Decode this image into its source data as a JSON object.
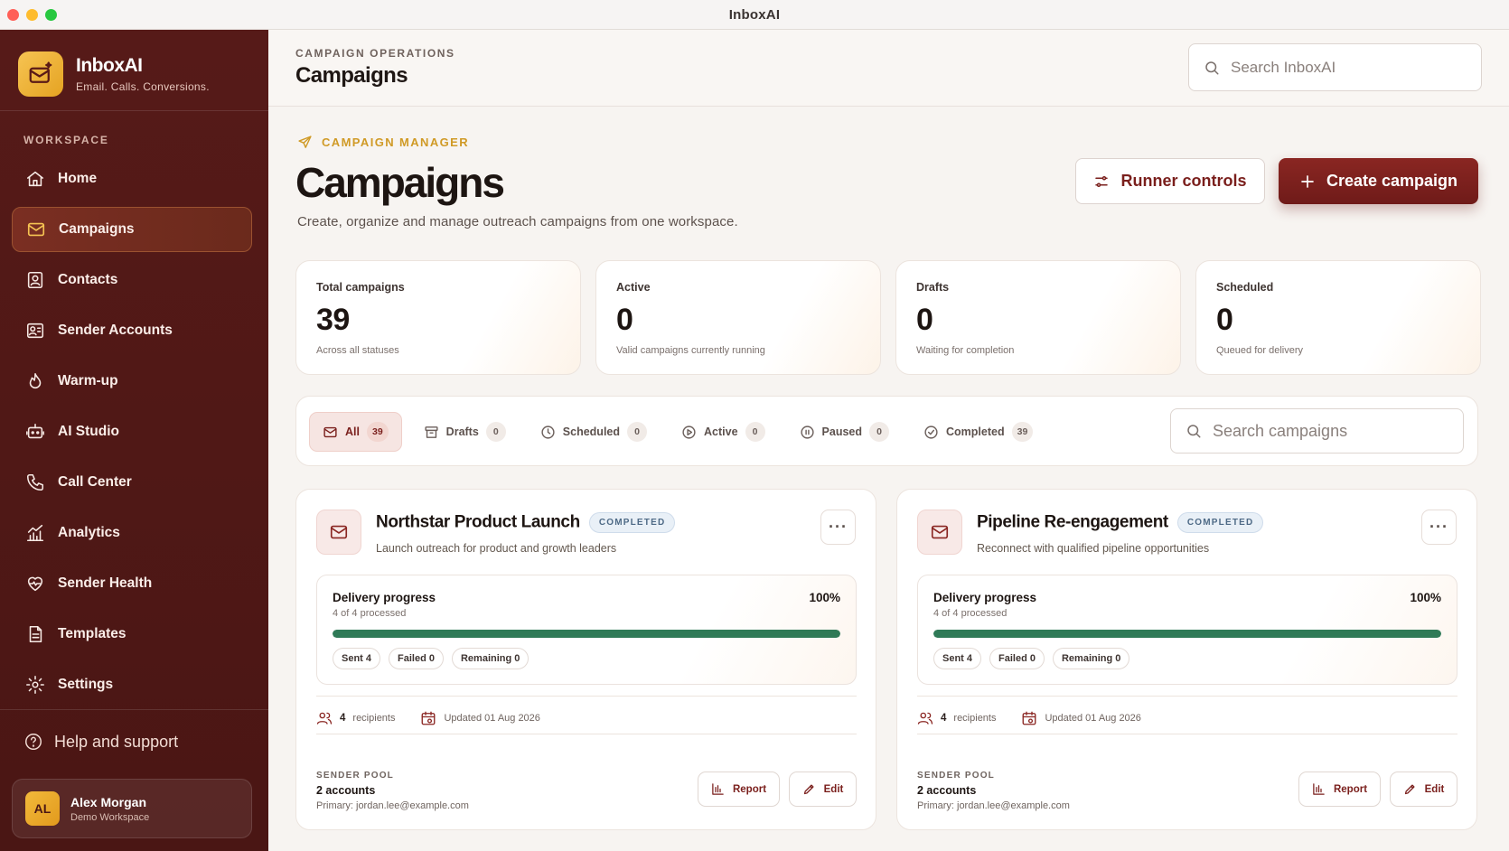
{
  "window": {
    "title": "InboxAI"
  },
  "brand": {
    "name": "InboxAI",
    "tagline": "Email. Calls. Conversions."
  },
  "sidebar": {
    "section_label": "WORKSPACE",
    "items": [
      {
        "label": "Home",
        "icon": "home-icon"
      },
      {
        "label": "Campaigns",
        "icon": "mail-icon",
        "active": true
      },
      {
        "label": "Contacts",
        "icon": "contacts-icon"
      },
      {
        "label": "Sender Accounts",
        "icon": "sender-accounts-icon"
      },
      {
        "label": "Warm-up",
        "icon": "flame-icon"
      },
      {
        "label": "AI Studio",
        "icon": "robot-icon"
      },
      {
        "label": "Call Center",
        "icon": "phone-icon"
      },
      {
        "label": "Analytics",
        "icon": "chart-icon"
      },
      {
        "label": "Sender Health",
        "icon": "heart-pulse-icon"
      },
      {
        "label": "Templates",
        "icon": "document-icon"
      },
      {
        "label": "Settings",
        "icon": "gear-icon"
      }
    ],
    "help_label": "Help and support",
    "user": {
      "initials": "AL",
      "name": "Alex Morgan",
      "workspace": "Demo Workspace"
    }
  },
  "topbar": {
    "section": "CAMPAIGN OPERATIONS",
    "title": "Campaigns",
    "search_placeholder": "Search InboxAI"
  },
  "header": {
    "kicker": "CAMPAIGN MANAGER",
    "title": "Campaigns",
    "subtitle": "Create, organize and manage outreach campaigns from one workspace.",
    "runner_label": "Runner controls",
    "create_label": "Create campaign"
  },
  "stats": [
    {
      "label": "Total campaigns",
      "value": "39",
      "note": "Across all statuses"
    },
    {
      "label": "Active",
      "value": "0",
      "note": "Valid campaigns currently running"
    },
    {
      "label": "Drafts",
      "value": "0",
      "note": "Waiting for completion"
    },
    {
      "label": "Scheduled",
      "value": "0",
      "note": "Queued for delivery"
    }
  ],
  "filters": {
    "tabs": [
      {
        "label": "All",
        "count": "39",
        "active": true
      },
      {
        "label": "Drafts",
        "count": "0"
      },
      {
        "label": "Scheduled",
        "count": "0"
      },
      {
        "label": "Active",
        "count": "0"
      },
      {
        "label": "Paused",
        "count": "0"
      },
      {
        "label": "Completed",
        "count": "39"
      }
    ],
    "search_placeholder": "Search campaigns"
  },
  "campaigns": [
    {
      "name": "Northstar Product Launch",
      "status": "COMPLETED",
      "description": "Launch outreach for product and growth leaders",
      "progress": {
        "title": "Delivery progress",
        "processed": "4 of 4 processed",
        "percent_label": "100%",
        "fraction": 1.0,
        "sent": "Sent 4",
        "failed": "Failed 0",
        "remaining": "Remaining 0"
      },
      "recipients_count": "4",
      "recipients_label": "recipients",
      "updated": "Updated 01 Aug 2026",
      "pool_label": "SENDER POOL",
      "pool_count": "2 accounts",
      "pool_primary": "Primary: jordan.lee@example.com",
      "report_label": "Report",
      "edit_label": "Edit"
    },
    {
      "name": "Pipeline Re-engagement",
      "status": "COMPLETED",
      "description": "Reconnect with qualified pipeline opportunities",
      "progress": {
        "title": "Delivery progress",
        "processed": "4 of 4 processed",
        "percent_label": "100%",
        "fraction": 1.0,
        "sent": "Sent 4",
        "failed": "Failed 0",
        "remaining": "Remaining 0"
      },
      "recipients_count": "4",
      "recipients_label": "recipients",
      "updated": "Updated 01 Aug 2026",
      "pool_label": "SENDER POOL",
      "pool_count": "2 accounts",
      "pool_primary": "Primary: jordan.lee@example.com",
      "report_label": "Report",
      "edit_label": "Edit"
    }
  ],
  "colors": {
    "sidebar_bg": "#561a18",
    "accent": "#7a1f1c",
    "gold": "#d09a26",
    "progress_green": "#2f7a57"
  }
}
